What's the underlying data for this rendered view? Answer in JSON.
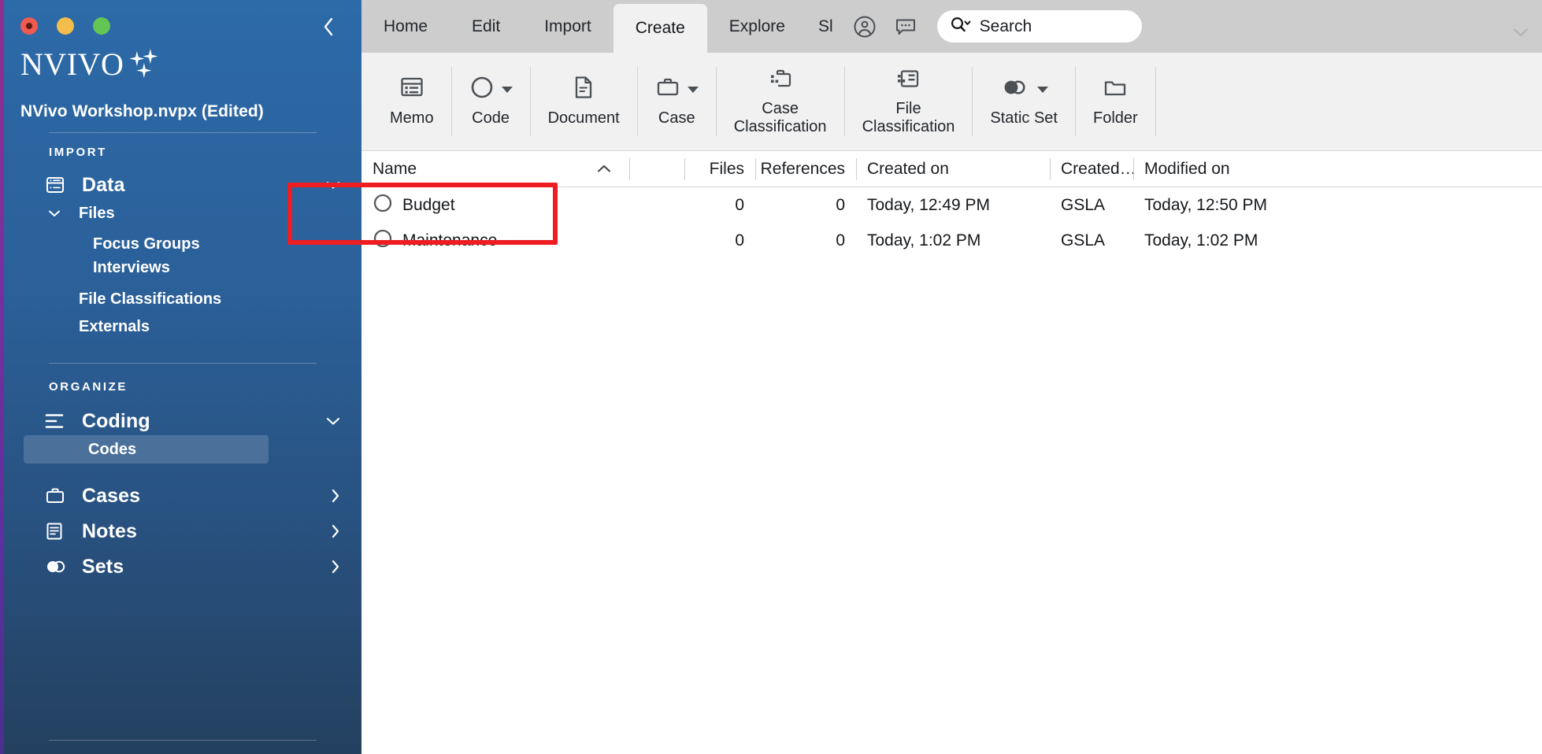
{
  "sidebar": {
    "window_controls": [
      "close",
      "minimize",
      "maximize"
    ],
    "collapse_icon": "chevron-left-icon",
    "logo_text": "NVIVO",
    "project_title": "NVivo Workshop.nvpx (Edited)",
    "sections": [
      {
        "label": "IMPORT"
      },
      {
        "label": "ORGANIZE"
      }
    ],
    "items": {
      "data": {
        "label": "Data",
        "icon": "database-icon",
        "chevron": "chevron-down-icon"
      },
      "files": {
        "label": "Files",
        "chevron": "chevron-down-icon"
      },
      "focus_groups": {
        "label": "Focus Groups"
      },
      "interviews": {
        "label": "Interviews"
      },
      "file_classifications": {
        "label": "File Classifications"
      },
      "externals": {
        "label": "Externals"
      },
      "coding": {
        "label": "Coding",
        "icon": "coding-lines-icon",
        "chevron": "chevron-down-icon"
      },
      "codes": {
        "label": "Codes",
        "selected": true
      },
      "cases": {
        "label": "Cases",
        "icon": "briefcase-icon",
        "chevron": "chevron-right-icon"
      },
      "notes": {
        "label": "Notes",
        "icon": "note-icon",
        "chevron": "chevron-right-icon"
      },
      "sets": {
        "label": "Sets",
        "icon": "sets-circles-icon",
        "chevron": "chevron-right-icon"
      }
    }
  },
  "tabbar": {
    "tabs": [
      {
        "label": "Home",
        "active": false
      },
      {
        "label": "Edit",
        "active": false
      },
      {
        "label": "Import",
        "active": false
      },
      {
        "label": "Create",
        "active": true
      },
      {
        "label": "Explore",
        "active": false
      },
      {
        "label": "Sl",
        "active": false,
        "truncated": true
      }
    ],
    "account_icon": "account-circle-icon",
    "chat_icon": "chat-bubble-icon",
    "collapse_icon": "chevron-down-icon"
  },
  "search": {
    "placeholder": "Search",
    "icon": "search-icon",
    "dropdown_icon": "chevron-down-icon"
  },
  "ribbon": {
    "buttons": [
      {
        "label": "Memo",
        "icon": "memo-icon",
        "has_dropdown": false
      },
      {
        "label": "Code",
        "icon": "circle-code-icon",
        "has_dropdown": true
      },
      {
        "label": "Document",
        "icon": "document-icon",
        "has_dropdown": false
      },
      {
        "label": "Case",
        "icon": "briefcase-icon",
        "has_dropdown": true
      },
      {
        "label": "Case\nClassification",
        "icon": "case-classification-icon",
        "has_dropdown": false
      },
      {
        "label": "File\nClassification",
        "icon": "file-classification-icon",
        "has_dropdown": false
      },
      {
        "label": "Static Set",
        "icon": "static-set-icon",
        "has_dropdown": true
      },
      {
        "label": "Folder",
        "icon": "folder-icon",
        "has_dropdown": false
      }
    ]
  },
  "table": {
    "columns": [
      {
        "key": "name",
        "label": "Name",
        "sort": "asc",
        "sort_icon": "chevron-up-icon"
      },
      {
        "key": "gap",
        "label": ""
      },
      {
        "key": "files",
        "label": "Files"
      },
      {
        "key": "references",
        "label": "References"
      },
      {
        "key": "created_on",
        "label": "Created on"
      },
      {
        "key": "created_by",
        "label": "Created…"
      },
      {
        "key": "modified_on",
        "label": "Modified on"
      }
    ],
    "rows": [
      {
        "icon": "circle-code-icon",
        "name": "Budget",
        "files": "0",
        "references": "0",
        "created_on": "Today, 12:49 PM",
        "created_by": "GSLA",
        "modified_on": "Today, 12:50 PM"
      },
      {
        "icon": "circle-code-icon",
        "name": "Maintenance",
        "files": "0",
        "references": "0",
        "created_on": "Today, 1:02 PM",
        "created_by": "GSLA",
        "modified_on": "Today, 1:02 PM"
      }
    ]
  },
  "annotation": {
    "color": "#ee1d22",
    "shape": "rectangle-highlight"
  }
}
